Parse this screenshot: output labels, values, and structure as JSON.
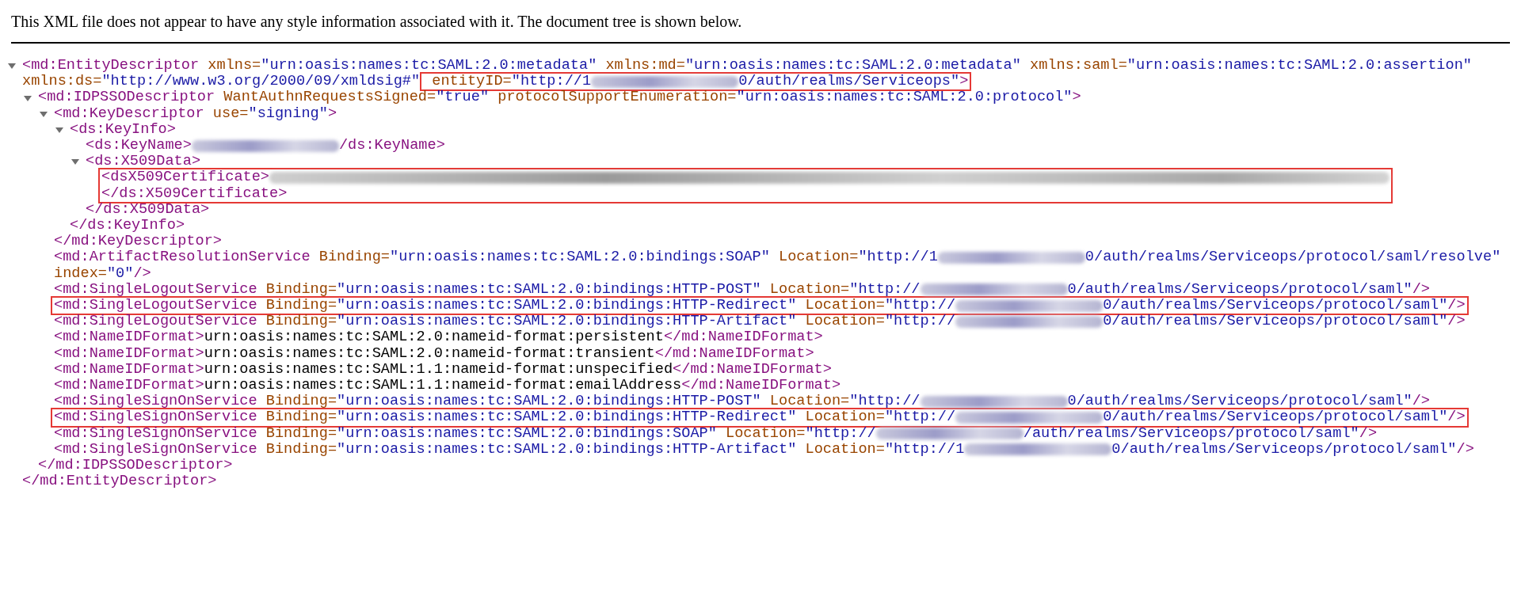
{
  "notice": "This XML file does not appear to have any style information associated with it. The document tree is shown below.",
  "tree": {
    "kind": "element",
    "expanded": true,
    "open": [
      [
        {
          "kind": "tag",
          "text": "<md:EntityDescriptor"
        },
        {
          "kind": "attr",
          "text": " xmlns="
        },
        {
          "kind": "value",
          "text": "\"urn:oasis:names:tc:SAML:2.0:metadata\""
        },
        {
          "kind": "attr",
          "text": " xmlns:md="
        },
        {
          "kind": "value",
          "text": "\"urn:oasis:names:tc:SAML:2.0:metadata\""
        },
        {
          "kind": "attr",
          "text": " xmlns:saml="
        },
        {
          "kind": "value",
          "text": "\"urn:oasis:names:tc:SAML:2.0:assertion\""
        }
      ],
      [
        {
          "kind": "attr",
          "text": "xmlns:ds="
        },
        {
          "kind": "value",
          "text": "\"http://www.w3.org/2000/09/xmldsig#\""
        },
        {
          "kind": "box",
          "parts": [
            {
              "kind": "attr",
              "text": " entityID="
            },
            {
              "kind": "value",
              "text": "\"http://1"
            },
            {
              "kind": "redacted"
            },
            {
              "kind": "value",
              "text": "0/auth/realms/Serviceops\""
            },
            {
              "kind": "tag",
              "text": ">"
            }
          ]
        }
      ]
    ],
    "children": [
      {
        "kind": "element",
        "expanded": true,
        "open": [
          [
            {
              "kind": "tag",
              "text": "<md:IDPSSODescriptor"
            },
            {
              "kind": "attr",
              "text": " WantAuthnRequestsSigned="
            },
            {
              "kind": "value",
              "text": "\"true\""
            },
            {
              "kind": "attr",
              "text": " protocolSupportEnumeration="
            },
            {
              "kind": "value",
              "text": "\"urn:oasis:names:tc:SAML:2.0:protocol\""
            },
            {
              "kind": "tag",
              "text": ">"
            }
          ]
        ],
        "children": [
          {
            "kind": "element",
            "expanded": true,
            "open": [
              [
                {
                  "kind": "tag",
                  "text": "<md:KeyDescriptor"
                },
                {
                  "kind": "attr",
                  "text": " use="
                },
                {
                  "kind": "value",
                  "text": "\"signing\""
                },
                {
                  "kind": "tag",
                  "text": ">"
                }
              ]
            ],
            "children": [
              {
                "kind": "element",
                "expanded": true,
                "open": [
                  [
                    {
                      "kind": "tag",
                      "text": "<ds:KeyInfo>"
                    }
                  ]
                ],
                "children": [
                  {
                    "kind": "leaf",
                    "boxed": false,
                    "lines": [
                      [
                        {
                          "kind": "tag",
                          "text": "<ds:KeyName>"
                        },
                        {
                          "kind": "redacted"
                        },
                        {
                          "kind": "tag",
                          "text": "/ds:KeyName>"
                        }
                      ]
                    ]
                  },
                  {
                    "kind": "element",
                    "expanded": true,
                    "open": [
                      [
                        {
                          "kind": "tag",
                          "text": "<ds:X509Data>"
                        }
                      ]
                    ],
                    "children": [
                      {
                        "kind": "leaf",
                        "boxed": true,
                        "lines": [
                          [
                            {
                              "kind": "tag",
                              "text": "<ds"
                            },
                            {
                              "kind": "tag",
                              "text": "X509Certificate>"
                            },
                            {
                              "kind": "redacted_long"
                            }
                          ],
                          [
                            {
                              "kind": "tag",
                              "text": "</ds:X509Certificate>"
                            }
                          ]
                        ]
                      }
                    ],
                    "close": [
                      [
                        {
                          "kind": "tag",
                          "text": "</ds:X509Data>"
                        }
                      ]
                    ]
                  }
                ],
                "close": [
                  [
                    {
                      "kind": "tag",
                      "text": "</ds:KeyInfo>"
                    }
                  ]
                ]
              }
            ],
            "close": [
              [
                {
                  "kind": "tag",
                  "text": "</md:KeyDescriptor>"
                }
              ]
            ]
          },
          {
            "kind": "leaf",
            "boxed": false,
            "lines": [
              [
                {
                  "kind": "tag",
                  "text": "<md:ArtifactResolutionService"
                },
                {
                  "kind": "attr",
                  "text": " Binding="
                },
                {
                  "kind": "value",
                  "text": "\"urn:oasis:names:tc:SAML:2.0:bindings:SOAP\""
                },
                {
                  "kind": "attr",
                  "text": " Location="
                },
                {
                  "kind": "value",
                  "text": "\"http://1"
                },
                {
                  "kind": "redacted"
                },
                {
                  "kind": "value",
                  "text": "0/auth/realms/Serviceops/protocol/saml/resolve\""
                }
              ],
              [
                {
                  "kind": "attr",
                  "text": "index="
                },
                {
                  "kind": "value",
                  "text": "\"0\""
                },
                {
                  "kind": "tag",
                  "text": "/>"
                }
              ]
            ]
          },
          {
            "kind": "leaf",
            "boxed": false,
            "lines": [
              [
                {
                  "kind": "tag",
                  "text": "<md:SingleLogoutService"
                },
                {
                  "kind": "attr",
                  "text": " Binding="
                },
                {
                  "kind": "value",
                  "text": "\"urn:oasis:names:tc:SAML:2.0:bindings:HTTP-POST\""
                },
                {
                  "kind": "attr",
                  "text": " Location="
                },
                {
                  "kind": "value",
                  "text": "\"http://"
                },
                {
                  "kind": "redacted"
                },
                {
                  "kind": "value",
                  "text": "0/auth/realms/Serviceops/protocol/saml\""
                },
                {
                  "kind": "tag",
                  "text": "/>"
                }
              ]
            ]
          },
          {
            "kind": "leaf",
            "boxed": true,
            "lines": [
              [
                {
                  "kind": "tag",
                  "text": "<md:SingleLogoutService"
                },
                {
                  "kind": "attr",
                  "text": " Binding="
                },
                {
                  "kind": "value",
                  "text": "\"urn:oasis:names:tc:SAML:2.0:bindings:HTTP-Redirect\""
                },
                {
                  "kind": "attr",
                  "text": " Location="
                },
                {
                  "kind": "value",
                  "text": "\"http://"
                },
                {
                  "kind": "redacted"
                },
                {
                  "kind": "value",
                  "text": "0/auth/realms/Serviceops/protocol/saml\""
                },
                {
                  "kind": "tag",
                  "text": "/>"
                }
              ]
            ]
          },
          {
            "kind": "leaf",
            "boxed": false,
            "lines": [
              [
                {
                  "kind": "tag",
                  "text": "<md:SingleLogoutService"
                },
                {
                  "kind": "attr",
                  "text": " Binding="
                },
                {
                  "kind": "value",
                  "text": "\"urn:oasis:names:tc:SAML:2.0:bindings:HTTP-Artifact\""
                },
                {
                  "kind": "attr",
                  "text": " Location="
                },
                {
                  "kind": "value",
                  "text": "\"http://"
                },
                {
                  "kind": "redacted"
                },
                {
                  "kind": "value",
                  "text": "0/auth/realms/Serviceops/protocol/saml\""
                },
                {
                  "kind": "tag",
                  "text": "/>"
                }
              ]
            ]
          },
          {
            "kind": "leaf",
            "boxed": false,
            "lines": [
              [
                {
                  "kind": "tag",
                  "text": "<md:NameIDFormat>"
                },
                {
                  "kind": "text",
                  "text": "urn:oasis:names:tc:SAML:2.0:nameid-format:persistent"
                },
                {
                  "kind": "tag",
                  "text": "</md:NameIDFormat>"
                }
              ]
            ]
          },
          {
            "kind": "leaf",
            "boxed": false,
            "lines": [
              [
                {
                  "kind": "tag",
                  "text": "<md:NameIDFormat>"
                },
                {
                  "kind": "text",
                  "text": "urn:oasis:names:tc:SAML:2.0:nameid-format:transient"
                },
                {
                  "kind": "tag",
                  "text": "</md:NameIDFormat>"
                }
              ]
            ]
          },
          {
            "kind": "leaf",
            "boxed": false,
            "lines": [
              [
                {
                  "kind": "tag",
                  "text": "<md:NameIDFormat>"
                },
                {
                  "kind": "text",
                  "text": "urn:oasis:names:tc:SAML:1.1:nameid-format:unspecified"
                },
                {
                  "kind": "tag",
                  "text": "</md:NameIDFormat>"
                }
              ]
            ]
          },
          {
            "kind": "leaf",
            "boxed": false,
            "lines": [
              [
                {
                  "kind": "tag",
                  "text": "<md:NameIDFormat>"
                },
                {
                  "kind": "text",
                  "text": "urn:oasis:names:tc:SAML:1.1:nameid-format:emailAddress"
                },
                {
                  "kind": "tag",
                  "text": "</md:NameIDFormat>"
                }
              ]
            ]
          },
          {
            "kind": "leaf",
            "boxed": false,
            "lines": [
              [
                {
                  "kind": "tag",
                  "text": "<md:SingleSignOnService"
                },
                {
                  "kind": "attr",
                  "text": " Binding="
                },
                {
                  "kind": "value",
                  "text": "\"urn:oasis:names:tc:SAML:2.0:bindings:HTTP-POST\""
                },
                {
                  "kind": "attr",
                  "text": " Location="
                },
                {
                  "kind": "value",
                  "text": "\"http://"
                },
                {
                  "kind": "redacted"
                },
                {
                  "kind": "value",
                  "text": "0/auth/realms/Serviceops/protocol/saml\""
                },
                {
                  "kind": "tag",
                  "text": "/>"
                }
              ]
            ]
          },
          {
            "kind": "leaf",
            "boxed": true,
            "lines": [
              [
                {
                  "kind": "tag",
                  "text": "<md:SingleSignOnService"
                },
                {
                  "kind": "attr",
                  "text": " Binding="
                },
                {
                  "kind": "value",
                  "text": "\"urn:oasis:names:tc:SAML:2.0:bindings:HTTP-Redirect\""
                },
                {
                  "kind": "attr",
                  "text": " Location="
                },
                {
                  "kind": "value",
                  "text": "\"http://"
                },
                {
                  "kind": "redacted"
                },
                {
                  "kind": "value",
                  "text": "0/auth/realms/Serviceops/protocol/saml\""
                },
                {
                  "kind": "tag",
                  "text": "/>"
                }
              ]
            ]
          },
          {
            "kind": "leaf",
            "boxed": false,
            "lines": [
              [
                {
                  "kind": "tag",
                  "text": "<md:SingleSignOnService"
                },
                {
                  "kind": "attr",
                  "text": " Binding="
                },
                {
                  "kind": "value",
                  "text": "\"urn:oasis:names:tc:SAML:2.0:bindings:SOAP\""
                },
                {
                  "kind": "attr",
                  "text": " Location="
                },
                {
                  "kind": "value",
                  "text": "\"http://"
                },
                {
                  "kind": "redacted"
                },
                {
                  "kind": "value",
                  "text": "/auth/realms/Serviceops/protocol/saml\""
                },
                {
                  "kind": "tag",
                  "text": "/>"
                }
              ]
            ]
          },
          {
            "kind": "leaf",
            "boxed": false,
            "lines": [
              [
                {
                  "kind": "tag",
                  "text": "<md:SingleSignOnService"
                },
                {
                  "kind": "attr",
                  "text": " Binding="
                },
                {
                  "kind": "value",
                  "text": "\"urn:oasis:names:tc:SAML:2.0:bindings:HTTP-Artifact\""
                },
                {
                  "kind": "attr",
                  "text": " Location="
                },
                {
                  "kind": "value",
                  "text": "\"http://1"
                },
                {
                  "kind": "redacted"
                },
                {
                  "kind": "value",
                  "text": "0/auth/realms/Serviceops/protocol/saml\""
                },
                {
                  "kind": "tag",
                  "text": "/>"
                }
              ]
            ]
          }
        ],
        "close": [
          [
            {
              "kind": "tag",
              "text": "</md:IDPSSODescriptor>"
            }
          ]
        ]
      }
    ],
    "close": [
      [
        {
          "kind": "tag",
          "text": "</md:EntityDescriptor>"
        }
      ]
    ]
  }
}
